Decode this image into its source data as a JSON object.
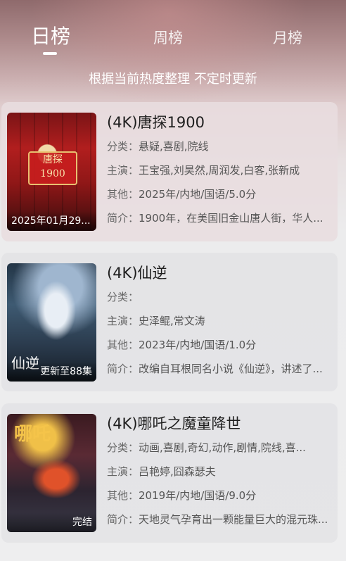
{
  "tabs": [
    {
      "label": "日榜",
      "active": true
    },
    {
      "label": "周榜",
      "active": false
    },
    {
      "label": "月榜",
      "active": false
    }
  ],
  "subtitle": "根据当前热度整理 不定时更新",
  "labels": {
    "category": "分类：",
    "cast": "主演：",
    "other": "其他：",
    "intro": "简介："
  },
  "items": [
    {
      "title": "(4K)唐探1900",
      "category": "悬疑,喜剧,院线",
      "cast": "王宝强,刘昊然,周润发,白客,张新成",
      "other": "2025年/内地/国语/5.0分",
      "intro": "1900年，在美国旧金山唐人街，华人...",
      "poster_caption": "2025年01月29...",
      "poster_text": "唐探\n1900"
    },
    {
      "title": "(4K)仙逆",
      "category": "",
      "cast": "史泽鲲,常文涛",
      "other": "2023年/内地/国语/1.0分",
      "intro": "改编自耳根同名小说《仙逆》，讲述了...",
      "poster_caption": "更新至88集",
      "poster_text": "仙逆"
    },
    {
      "title": "(4K)哪吒之魔童降世",
      "category": "动画,喜剧,奇幻,动作,剧情,院线,喜...",
      "cast": "吕艳婷,囧森瑟夫",
      "other": "2019年/内地/国语/9.0分",
      "intro": "天地灵气孕育出一颗能量巨大的混元珠...",
      "poster_caption": "完结",
      "poster_text": "哪吒"
    }
  ]
}
